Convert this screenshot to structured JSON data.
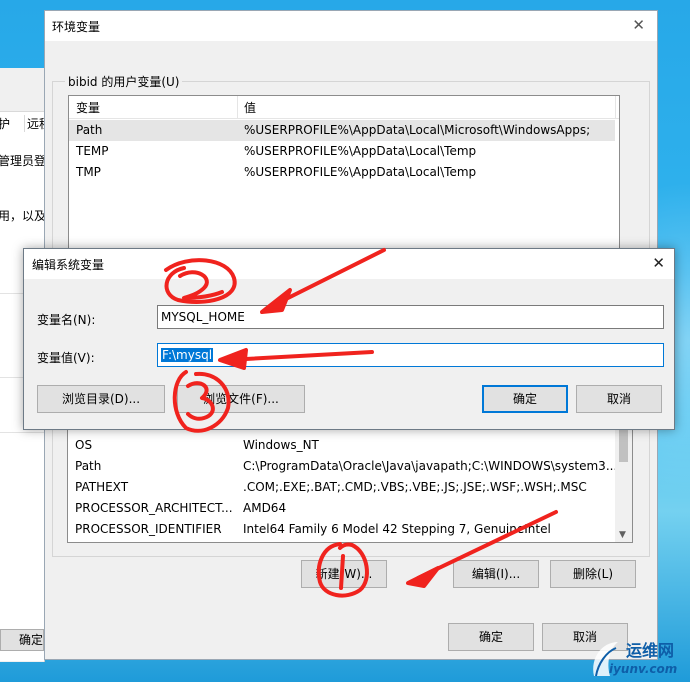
{
  "background_window": {
    "tabs": [
      "护",
      "远程"
    ],
    "lines": [
      "管理员登",
      "用，以及"
    ],
    "ok_label": "确定"
  },
  "env_window": {
    "title": "环境变量",
    "user_group_label": "bibid 的用户变量(U)",
    "columns": [
      "变量",
      "值"
    ],
    "user_vars": [
      {
        "name": "Path",
        "value": "%USERPROFILE%\\AppData\\Local\\Microsoft\\WindowsApps;"
      },
      {
        "name": "TEMP",
        "value": "%USERPROFILE%\\AppData\\Local\\Temp"
      },
      {
        "name": "TMP",
        "value": "%USERPROFILE%\\AppData\\Local\\Temp"
      }
    ],
    "system_vars": [
      {
        "name": "OS",
        "value": "Windows_NT"
      },
      {
        "name": "Path",
        "value": "C:\\ProgramData\\Oracle\\Java\\javapath;C:\\WINDOWS\\system3..."
      },
      {
        "name": "PATHEXT",
        "value": ".COM;.EXE;.BAT;.CMD;.VBS;.VBE;.JS;.JSE;.WSF;.WSH;.MSC"
      },
      {
        "name": "PROCESSOR_ARCHITECT...",
        "value": "AMD64"
      },
      {
        "name": "PROCESSOR_IDENTIFIER",
        "value": "Intel64 Family 6 Model 42 Stepping 7, GenuineIntel"
      }
    ],
    "new_button": "新建(W)...",
    "edit_button": "编辑(I)...",
    "delete_button": "删除(L)",
    "ok_button": "确定",
    "cancel_button": "取消"
  },
  "edit_dialog": {
    "title": "编辑系统变量",
    "name_label": "变量名(N):",
    "name_value": "MYSQL_HOME",
    "value_label": "变量值(V):",
    "value_value": "F:\\mysql",
    "browse_dir_button": "浏览目录(D)...",
    "browse_file_button": "浏览文件(F)...",
    "ok_button": "确定",
    "cancel_button": "取消"
  },
  "watermark": {
    "text": "运维网",
    "url": "iyunv.com"
  },
  "colors": {
    "annotation_red": "#f0231e",
    "selection_blue": "#0078d7"
  }
}
